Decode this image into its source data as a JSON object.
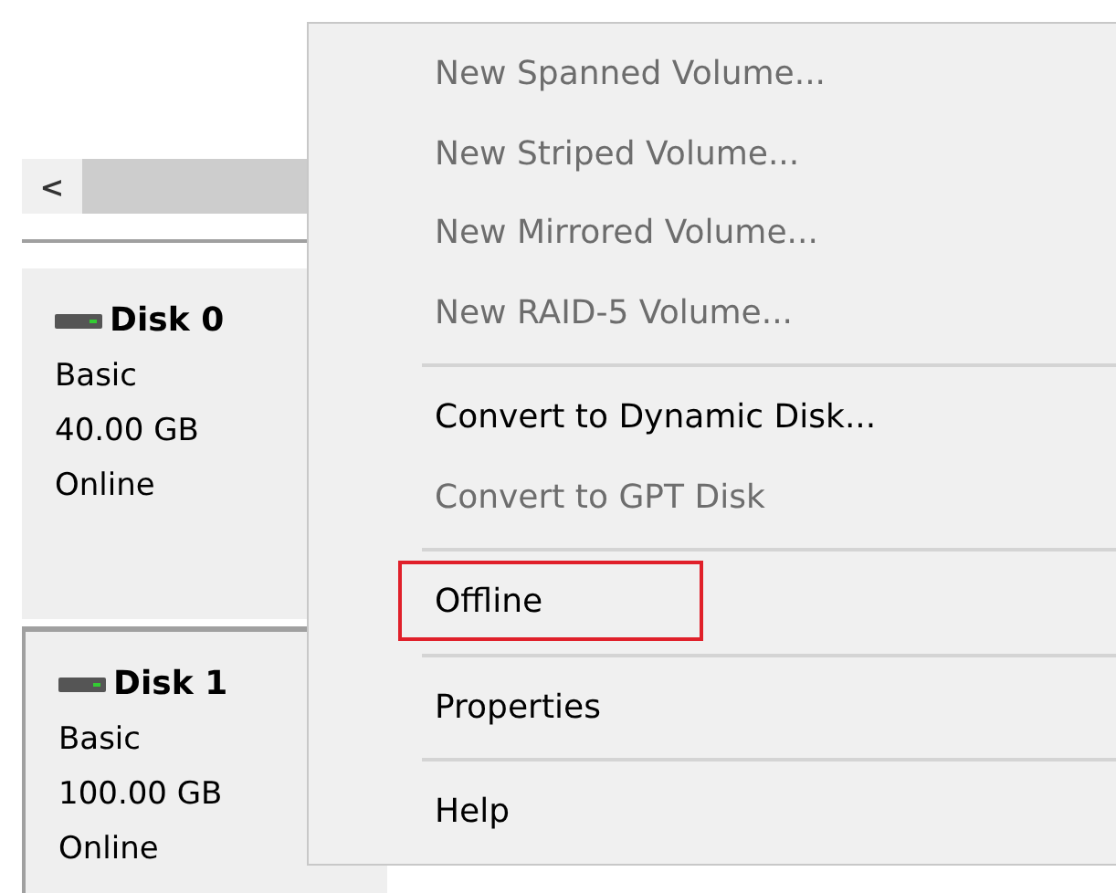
{
  "scrollbar": {
    "left_arrow": "<"
  },
  "disks": [
    {
      "name": "Disk 0",
      "type": "Basic",
      "size": "40.00 GB",
      "status": "Online",
      "selected": false
    },
    {
      "name": "Disk 1",
      "type": "Basic",
      "size": "100.00 GB",
      "status": "Online",
      "selected": true
    }
  ],
  "context_menu": {
    "items": [
      {
        "kind": "item",
        "label": "New Spanned Volume...",
        "disabled": true,
        "highlighted": false
      },
      {
        "kind": "item",
        "label": "New Striped Volume...",
        "disabled": true,
        "highlighted": false
      },
      {
        "kind": "item",
        "label": "New Mirrored Volume...",
        "disabled": true,
        "highlighted": false
      },
      {
        "kind": "item",
        "label": "New RAID-5 Volume...",
        "disabled": true,
        "highlighted": false
      },
      {
        "kind": "separator"
      },
      {
        "kind": "item",
        "label": "Convert to Dynamic Disk...",
        "disabled": false,
        "highlighted": false
      },
      {
        "kind": "item",
        "label": "Convert to GPT Disk",
        "disabled": true,
        "highlighted": false
      },
      {
        "kind": "separator"
      },
      {
        "kind": "item",
        "label": "Offline",
        "disabled": false,
        "highlighted": true
      },
      {
        "kind": "separator"
      },
      {
        "kind": "item",
        "label": "Properties",
        "disabled": false,
        "highlighted": false
      },
      {
        "kind": "separator"
      },
      {
        "kind": "item",
        "label": "Help",
        "disabled": false,
        "highlighted": false
      }
    ]
  }
}
